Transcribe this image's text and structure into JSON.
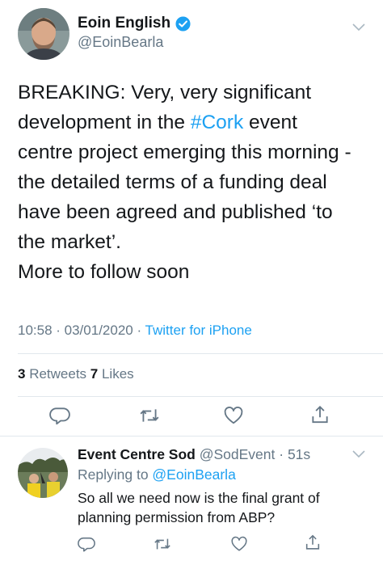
{
  "tweet": {
    "author": {
      "name": "Eoin English",
      "handle": "@EoinBearla"
    },
    "text_lines": [
      "BREAKING: Very, very significant",
      "development in the ",
      "centre project emerging this morning -",
      "the detailed terms of a funding deal",
      "have been agreed and published ‘to",
      "the market’.",
      "More to follow soon"
    ],
    "hashtag": "#Cork",
    "hashtag_after": " event",
    "time": "10:58 · 03/01/2020 · ",
    "source": "Twitter for iPhone",
    "retweets_count": "3",
    "retweets_label": " Retweets  ",
    "likes_count": "7",
    "likes_label": " Likes"
  },
  "reply": {
    "name": "Event Centre Sod",
    "handle_time": " @SodEvent · 51s",
    "replying_prefix": "Replying to ",
    "replying_to": "@EoinBearla",
    "text_lines": [
      "So all we need now is the final grant of",
      "planning permission from ABP?"
    ]
  },
  "colors": {
    "link": "#1da1f2",
    "secondary": "#657786",
    "primary": "#14171a",
    "divider": "#e1e8ed"
  }
}
